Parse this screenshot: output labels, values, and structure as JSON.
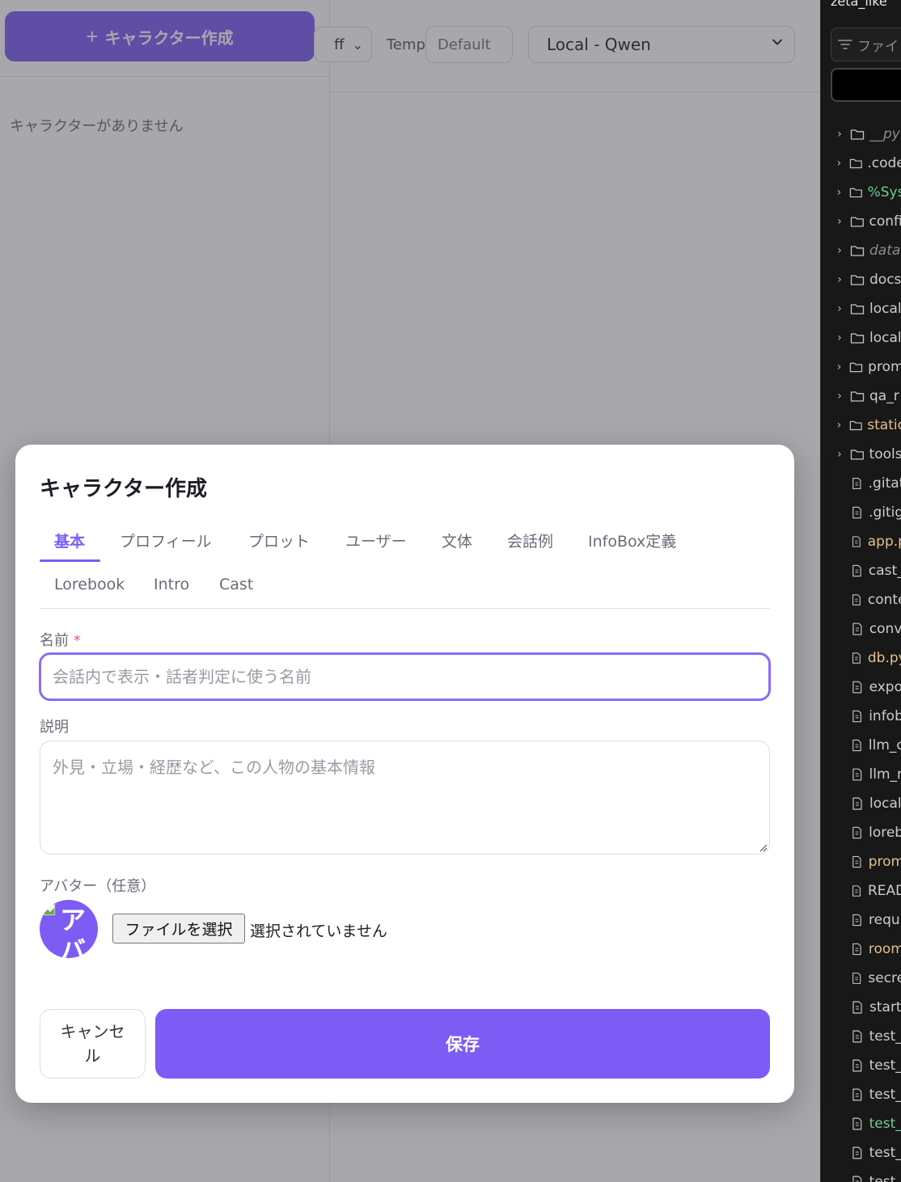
{
  "sidebar": {
    "create_button_icon": "plus-icon",
    "create_button_label": "キャラクター作成",
    "empty_message": "キャラクターがありません"
  },
  "header": {
    "partial_select_value": "ff",
    "temp_label": "Temp",
    "temp_placeholder": "Default",
    "model_value": "Local - Qwen"
  },
  "modal": {
    "title": "キャラクター作成",
    "tabs": [
      {
        "label": "基本",
        "active": true
      },
      {
        "label": "プロフィール"
      },
      {
        "label": "プロット"
      },
      {
        "label": "ユーザー"
      },
      {
        "label": "文体"
      },
      {
        "label": "会話例"
      },
      {
        "label": "InfoBox定義"
      },
      {
        "label": "Lorebook"
      },
      {
        "label": "Intro"
      },
      {
        "label": "Cast"
      }
    ],
    "name_label": "名前",
    "required_mark": "*",
    "name_placeholder": "会話内で表示・話者判定に使う名前",
    "description_label": "説明",
    "description_placeholder": "外見・立場・経歴など、この人物の基本情報",
    "avatar_label": "アバター（任意）",
    "avatar_alt": "アバ",
    "file_button": "ファイルを選択",
    "file_status": "選択されていません",
    "cancel_button": "キャンセル",
    "save_button": "保存"
  },
  "explorer": {
    "title": "zeta_like",
    "filter_placeholder": "ファイ",
    "items": [
      {
        "name": "__py",
        "type": "folder",
        "color": "#8b8b8b",
        "italic": true
      },
      {
        "name": ".code",
        "type": "folder",
        "color": "#cccccc"
      },
      {
        "name": "%Sys",
        "type": "folder",
        "color": "#73c991"
      },
      {
        "name": "confi",
        "type": "folder",
        "color": "#cccccc"
      },
      {
        "name": "data",
        "type": "folder",
        "color": "#8b8b8b",
        "italic": true
      },
      {
        "name": "docs",
        "type": "folder",
        "color": "#cccccc"
      },
      {
        "name": "local",
        "type": "folder",
        "color": "#cccccc"
      },
      {
        "name": "local",
        "type": "folder",
        "color": "#cccccc"
      },
      {
        "name": "prom",
        "type": "folder",
        "color": "#cccccc"
      },
      {
        "name": "qa_r",
        "type": "folder",
        "color": "#cccccc"
      },
      {
        "name": "static",
        "type": "folder",
        "color": "#e2c08d"
      },
      {
        "name": "tools",
        "type": "folder",
        "color": "#cccccc"
      },
      {
        "name": ".gitat",
        "type": "file",
        "color": "#cccccc"
      },
      {
        "name": ".gitig",
        "type": "file",
        "color": "#cccccc"
      },
      {
        "name": "app.p",
        "type": "file",
        "color": "#e2c08d"
      },
      {
        "name": "cast_",
        "type": "file",
        "color": "#cccccc"
      },
      {
        "name": "conte",
        "type": "file",
        "color": "#cccccc"
      },
      {
        "name": "conv",
        "type": "file",
        "color": "#cccccc"
      },
      {
        "name": "db.py",
        "type": "file",
        "color": "#e2c08d"
      },
      {
        "name": "expo",
        "type": "file",
        "color": "#cccccc"
      },
      {
        "name": "infob",
        "type": "file",
        "color": "#cccccc"
      },
      {
        "name": "llm_c",
        "type": "file",
        "color": "#cccccc"
      },
      {
        "name": "llm_r",
        "type": "file",
        "color": "#cccccc"
      },
      {
        "name": "local",
        "type": "file",
        "color": "#cccccc"
      },
      {
        "name": "loreb",
        "type": "file",
        "color": "#cccccc"
      },
      {
        "name": "prom",
        "type": "file",
        "color": "#e2c08d"
      },
      {
        "name": "READ",
        "type": "file",
        "color": "#cccccc"
      },
      {
        "name": "requi",
        "type": "file",
        "color": "#cccccc"
      },
      {
        "name": "room",
        "type": "file",
        "color": "#e2c08d"
      },
      {
        "name": "secre",
        "type": "file",
        "color": "#cccccc"
      },
      {
        "name": "start",
        "type": "file",
        "color": "#cccccc"
      },
      {
        "name": "test_",
        "type": "file",
        "color": "#cccccc"
      },
      {
        "name": "test_",
        "type": "file",
        "color": "#cccccc"
      },
      {
        "name": "test_",
        "type": "file",
        "color": "#cccccc"
      },
      {
        "name": "test_",
        "type": "file",
        "color": "#73c991"
      },
      {
        "name": "test_",
        "type": "file",
        "color": "#cccccc"
      },
      {
        "name": "test_",
        "type": "file",
        "color": "#cccccc"
      }
    ]
  },
  "colors": {
    "accent": "#7c5cf5",
    "overlay": "rgba(60,60,72,0.45)",
    "explorer_bg": "#181818"
  }
}
